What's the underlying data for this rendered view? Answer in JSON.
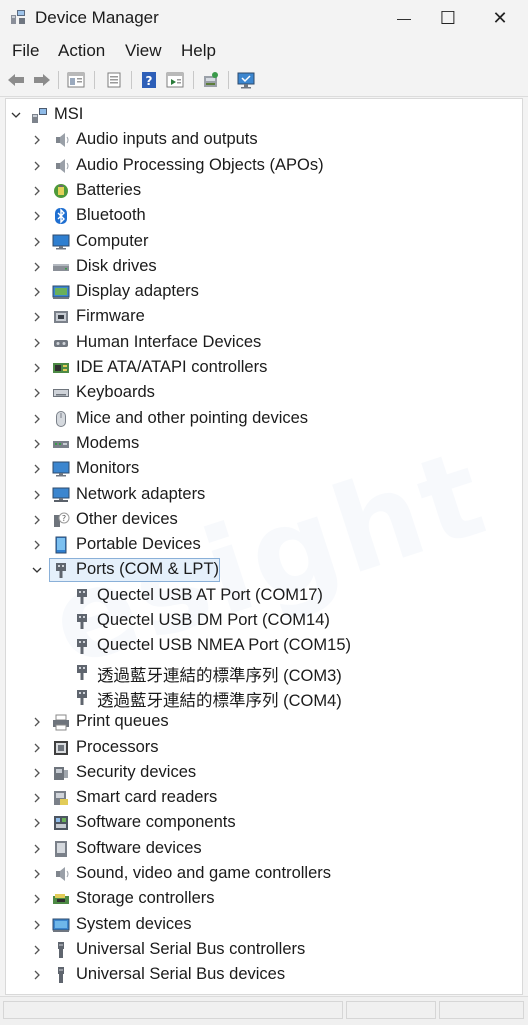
{
  "window": {
    "title": "Device Manager",
    "minimize_glyph": "—",
    "maximize_glyph": "☐",
    "close_glyph": "✕"
  },
  "menu": [
    "File",
    "Action",
    "View",
    "Help"
  ],
  "toolbar": [
    "back-icon",
    "forward-icon",
    "properties-sheet-icon",
    "driver-icon",
    "help-icon",
    "view-icon",
    "scan-hardware-icon",
    "monitor-icon"
  ],
  "tree": {
    "root": "MSI",
    "categories": [
      {
        "label": "Audio inputs and outputs",
        "icon": "speaker-icon"
      },
      {
        "label": "Audio Processing Objects (APOs)",
        "icon": "speaker-icon"
      },
      {
        "label": "Batteries",
        "icon": "battery-icon"
      },
      {
        "label": "Bluetooth",
        "icon": "bluetooth-icon"
      },
      {
        "label": "Computer",
        "icon": "computer-icon"
      },
      {
        "label": "Disk drives",
        "icon": "disk-icon"
      },
      {
        "label": "Display adapters",
        "icon": "display-adapter-icon"
      },
      {
        "label": "Firmware",
        "icon": "firmware-icon"
      },
      {
        "label": "Human Interface Devices",
        "icon": "hid-icon"
      },
      {
        "label": "IDE ATA/ATAPI controllers",
        "icon": "ide-icon"
      },
      {
        "label": "Keyboards",
        "icon": "keyboard-icon"
      },
      {
        "label": "Mice and other pointing devices",
        "icon": "mouse-icon"
      },
      {
        "label": "Modems",
        "icon": "modem-icon"
      },
      {
        "label": "Monitors",
        "icon": "monitor-icon"
      },
      {
        "label": "Network adapters",
        "icon": "network-icon"
      },
      {
        "label": "Other devices",
        "icon": "other-devices-icon"
      },
      {
        "label": "Portable Devices",
        "icon": "portable-device-icon"
      },
      {
        "label": "Ports (COM & LPT)",
        "icon": "port-icon",
        "expanded": true,
        "selected": true,
        "children": [
          {
            "label": "Quectel USB AT Port (COM17)",
            "icon": "port-icon"
          },
          {
            "label": "Quectel USB DM Port (COM14)",
            "icon": "port-icon"
          },
          {
            "label": "Quectel USB NMEA Port (COM15)",
            "icon": "port-icon"
          },
          {
            "label": "透過藍牙連結的標準序列 (COM3)",
            "icon": "port-icon"
          },
          {
            "label": "透過藍牙連結的標準序列 (COM4)",
            "icon": "port-icon"
          }
        ]
      },
      {
        "label": "Print queues",
        "icon": "printer-icon"
      },
      {
        "label": "Processors",
        "icon": "processor-icon"
      },
      {
        "label": "Security devices",
        "icon": "security-icon"
      },
      {
        "label": "Smart card readers",
        "icon": "smart-card-icon"
      },
      {
        "label": "Software components",
        "icon": "software-component-icon"
      },
      {
        "label": "Software devices",
        "icon": "software-device-icon"
      },
      {
        "label": "Sound, video and game controllers",
        "icon": "speaker-icon"
      },
      {
        "label": "Storage controllers",
        "icon": "storage-icon"
      },
      {
        "label": "System devices",
        "icon": "system-icon"
      },
      {
        "label": "Universal Serial Bus controllers",
        "icon": "usb-icon"
      },
      {
        "label": "Universal Serial Bus devices",
        "icon": "usb-icon"
      }
    ]
  },
  "colors": {
    "selection": "#e5f0fb",
    "selection_border": "#8ab0d8",
    "accent": "#1e6fc9"
  }
}
